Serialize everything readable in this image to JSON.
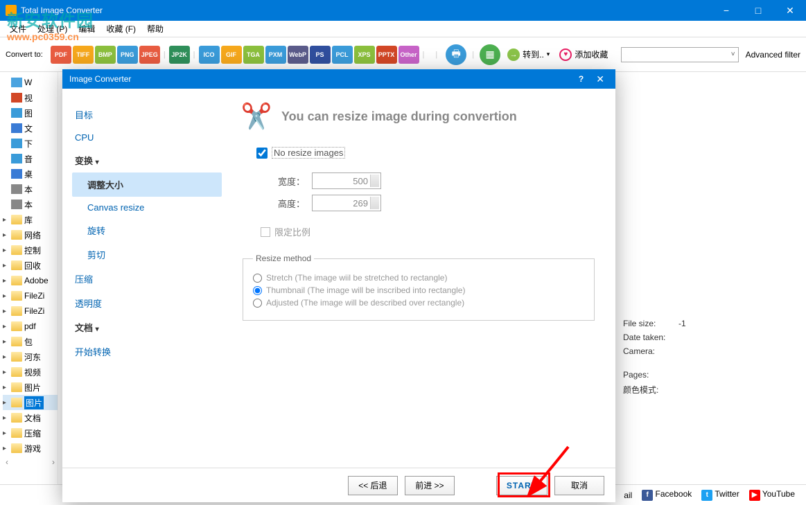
{
  "app": {
    "title": "Total Image Converter"
  },
  "window_controls": {
    "min": "−",
    "max": "□",
    "close": "✕"
  },
  "watermark": {
    "line1": "新安软件园",
    "line2": "www.pc0359.cn"
  },
  "menu": [
    "文件",
    "处理 (P)",
    "编辑",
    "收藏 (F)",
    "帮助"
  ],
  "toolbar": {
    "convert_label": "Convert to:",
    "formats": [
      {
        "label": "PDF",
        "color": "#e85c41"
      },
      {
        "label": "TIFF",
        "color": "#f6a81c"
      },
      {
        "label": "BMP",
        "color": "#8bbf3d"
      },
      {
        "label": "PNG",
        "color": "#3a9bd9"
      },
      {
        "label": "JPEG",
        "color": "#e85c41"
      },
      {
        "label": "JP2K",
        "color": "#2f8f5a"
      },
      {
        "label": "ICO",
        "color": "#3a9bd9"
      },
      {
        "label": "GIF",
        "color": "#f6a81c"
      },
      {
        "label": "TGA",
        "color": "#8bbf3d"
      },
      {
        "label": "PXM",
        "color": "#3a9bd9"
      },
      {
        "label": "WebP",
        "color": "#5b5b8a"
      },
      {
        "label": "PS",
        "color": "#304f9e"
      },
      {
        "label": "PCL",
        "color": "#3a9bd9"
      },
      {
        "label": "XPS",
        "color": "#8bbf3d"
      },
      {
        "label": "PPTX",
        "color": "#d24726"
      },
      {
        "label": "Other",
        "color": "#c763c7"
      }
    ],
    "goto": "转到..",
    "fav": "添加收藏",
    "advanced_filter": "Advanced filter"
  },
  "tree": [
    {
      "icon": "cloud",
      "label": "W",
      "color": "#4aa3df"
    },
    {
      "icon": "video",
      "label": "视",
      "color": "#d24726"
    },
    {
      "icon": "image",
      "label": "图",
      "color": "#3a9bd9"
    },
    {
      "icon": "doc",
      "label": "文",
      "color": "#3a7bd5"
    },
    {
      "icon": "down",
      "label": "下",
      "color": "#3a9bd9"
    },
    {
      "icon": "music",
      "label": "音",
      "color": "#3a9bd9"
    },
    {
      "icon": "desktop",
      "label": "桌",
      "color": "#3a7bd5"
    },
    {
      "icon": "disk",
      "label": "本",
      "color": "#888"
    },
    {
      "icon": "disk",
      "label": "本",
      "color": "#888"
    },
    {
      "icon": "folder",
      "label": "库"
    },
    {
      "icon": "folder",
      "label": "网络"
    },
    {
      "icon": "folder",
      "label": "控制"
    },
    {
      "icon": "folder",
      "label": "回收"
    },
    {
      "icon": "folder",
      "label": "Adobe"
    },
    {
      "icon": "folder",
      "label": "FileZi"
    },
    {
      "icon": "folder",
      "label": "FileZi"
    },
    {
      "icon": "folder",
      "label": "pdf"
    },
    {
      "icon": "folder",
      "label": "包"
    },
    {
      "icon": "folder",
      "label": "河东"
    },
    {
      "icon": "folder",
      "label": "视频"
    },
    {
      "icon": "folder",
      "label": "图片"
    },
    {
      "icon": "folder",
      "label": "图片",
      "selected": true
    },
    {
      "icon": "folder",
      "label": "文档"
    },
    {
      "icon": "folder",
      "label": "压缩"
    },
    {
      "icon": "folder",
      "label": "游戏"
    }
  ],
  "info": {
    "filesize_label": "File size:",
    "filesize_value": "-1",
    "datetaken_label": "Date taken:",
    "camera_label": "Camera:",
    "pages_label": "Pages:",
    "colormode_label": "颜色模式:"
  },
  "modal": {
    "title": "Image Converter",
    "sidebar": {
      "target": "目标",
      "cpu": "CPU",
      "transform": "变换",
      "subs": [
        "调整大小",
        "Canvas resize",
        "旋转",
        "剪切"
      ],
      "compress": "压缩",
      "transparency": "透明度",
      "document": "文档",
      "start": "开始转换"
    },
    "content": {
      "title": "You can resize image during convertion",
      "no_resize": "No resize images",
      "width_label": "宽度：",
      "width_value": "500",
      "height_label": "高度：",
      "height_value": "269",
      "constrain": "限定比例",
      "method_legend": "Resize method",
      "radios": [
        "Stretch (The image wiil be stretched to rectangle)",
        "Thumbnail  (The image will be inscribed into rectangle)",
        "Adjusted (The image will be described over rectangle)"
      ]
    },
    "footer": {
      "back": "<<  后退",
      "forward": "前进  >>",
      "start": "START",
      "cancel": "取消"
    }
  },
  "social": {
    "mail": "ail",
    "facebook": "Facebook",
    "twitter": "Twitter",
    "youtube": "YouTube"
  }
}
